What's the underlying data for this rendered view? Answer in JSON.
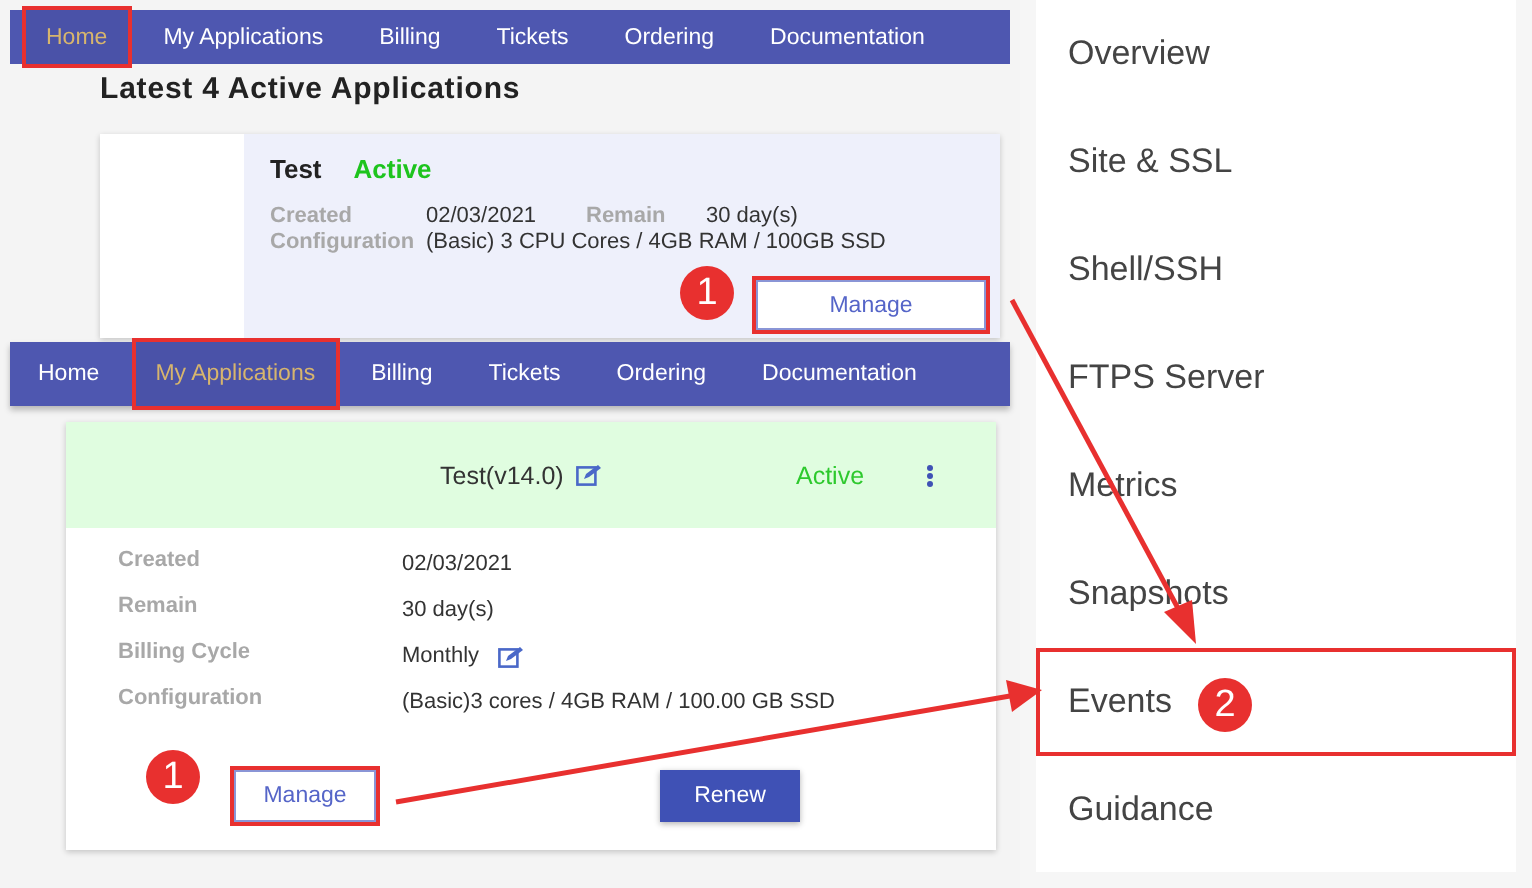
{
  "home_view": {
    "nav": [
      {
        "label": "Home",
        "selected": true,
        "highlighted": true
      },
      {
        "label": "My Applications",
        "selected": false,
        "highlighted": false
      },
      {
        "label": "Billing",
        "selected": false,
        "highlighted": false
      },
      {
        "label": "Tickets",
        "selected": false,
        "highlighted": false
      },
      {
        "label": "Ordering",
        "selected": false,
        "highlighted": false
      },
      {
        "label": "Documentation",
        "selected": false,
        "highlighted": false
      }
    ],
    "heading": "Latest 4 Active Applications",
    "application": {
      "name": "Test",
      "status": "Active",
      "fields": [
        {
          "label": "Created",
          "value": "02/03/2021"
        },
        {
          "label": "Remain",
          "value": "30 day(s)"
        },
        {
          "label": "Configuration",
          "value": "(Basic) 3 CPU Cores / 4GB RAM / 100GB SSD"
        }
      ],
      "button": {
        "label": "Manage",
        "highlighted": true,
        "callout": "1"
      }
    }
  },
  "applications_view": {
    "nav": [
      {
        "label": "Home",
        "selected": false,
        "highlighted": false
      },
      {
        "label": "My Applications",
        "selected": true,
        "highlighted": true
      },
      {
        "label": "Billing",
        "selected": false,
        "highlighted": false
      },
      {
        "label": "Tickets",
        "selected": false,
        "highlighted": false
      },
      {
        "label": "Ordering",
        "selected": false,
        "highlighted": false
      },
      {
        "label": "Documentation",
        "selected": false,
        "highlighted": false
      }
    ],
    "card": {
      "title": "Test(v14.0)",
      "status": "Active",
      "fields": [
        {
          "label": "Created",
          "value": "02/03/2021",
          "editable": false
        },
        {
          "label": "Remain",
          "value": "30 day(s)",
          "editable": false
        },
        {
          "label": "Billing Cycle",
          "value": "Monthly",
          "editable": true
        },
        {
          "label": "Configuration",
          "value": "(Basic)3 cores / 4GB RAM / 100.00 GB SSD",
          "editable": false
        }
      ],
      "buttons": [
        {
          "label": "Manage",
          "kind": "outline",
          "highlighted": true,
          "callout": "1"
        },
        {
          "label": "Renew",
          "kind": "primary",
          "highlighted": false
        }
      ]
    }
  },
  "side_menu": {
    "items": [
      {
        "label": "Overview",
        "highlighted": false
      },
      {
        "label": "Site & SSL",
        "highlighted": false
      },
      {
        "label": "Shell/SSH",
        "highlighted": false
      },
      {
        "label": "FTPS Server",
        "highlighted": false
      },
      {
        "label": "Metrics",
        "highlighted": false
      },
      {
        "label": "Snapshots",
        "highlighted": false
      },
      {
        "label": "Events",
        "highlighted": true,
        "callout": "2"
      },
      {
        "label": "Guidance",
        "highlighted": false
      }
    ]
  }
}
